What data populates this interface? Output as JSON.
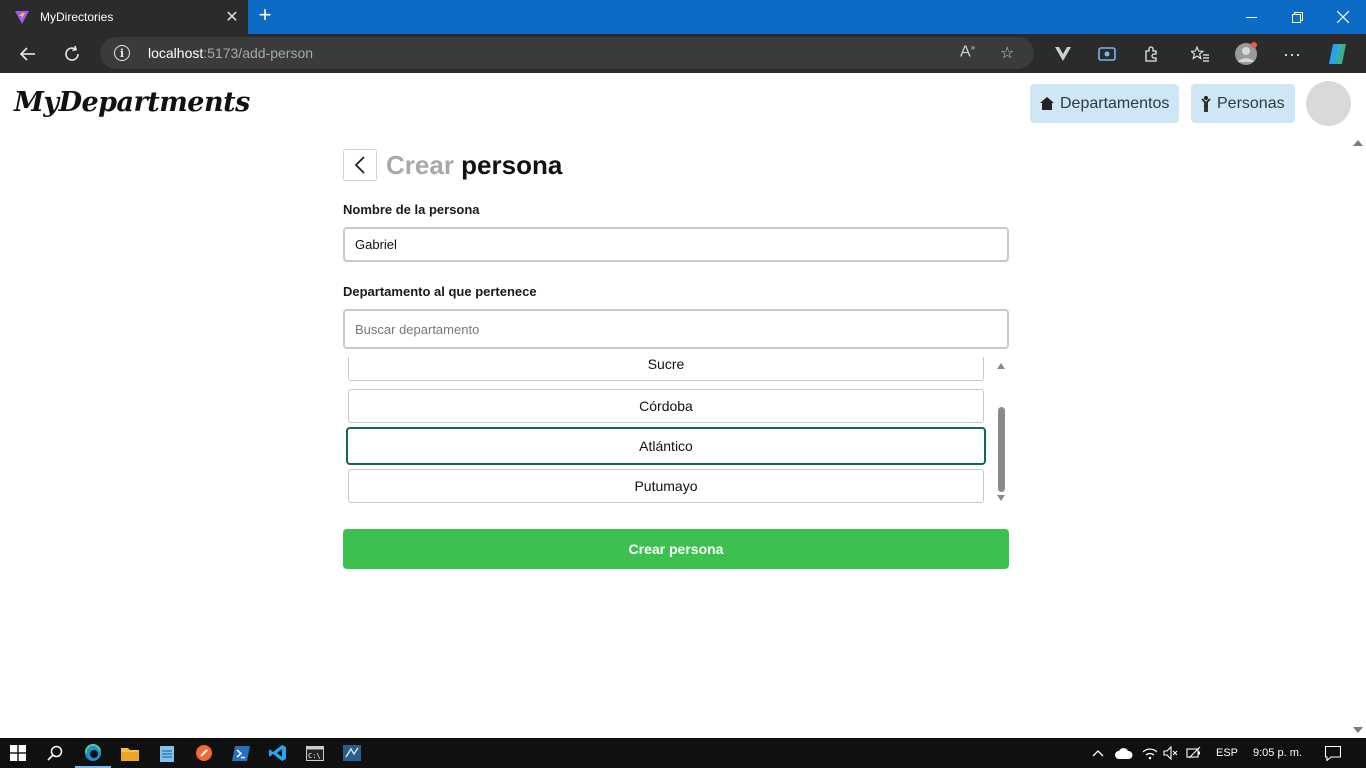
{
  "browser": {
    "tab_title": "MyDirectories",
    "tab_close": "✕",
    "new_tab": "+",
    "url_host": "localhost",
    "url_path": ":5173/add-person",
    "colors": {
      "titlebar": "#0c6bc4",
      "toolbar": "#2b2b2b"
    }
  },
  "app": {
    "logo": "MyDepartments",
    "nav": [
      {
        "label": "Departamentos",
        "icon": "home-icon"
      },
      {
        "label": "Personas",
        "icon": "person-icon"
      }
    ]
  },
  "form": {
    "title_part1": "Crear",
    "title_part2": "persona",
    "name_label": "Nombre de la persona",
    "name_value": "Gabriel",
    "department_label": "Departamento al que pertenece",
    "search_placeholder": "Buscar departamento",
    "departments": [
      "Sucre",
      "Córdoba",
      "Atlántico",
      "Putumayo"
    ],
    "selected_department": "Atlántico",
    "submit_label": "Crear persona",
    "colors": {
      "submit": "#3cc04f",
      "selected_border": "#0f6b4f",
      "nav_bg": "#cfe7f5"
    }
  },
  "taskbar": {
    "language": "ESP",
    "time": "9:05 p. m."
  }
}
